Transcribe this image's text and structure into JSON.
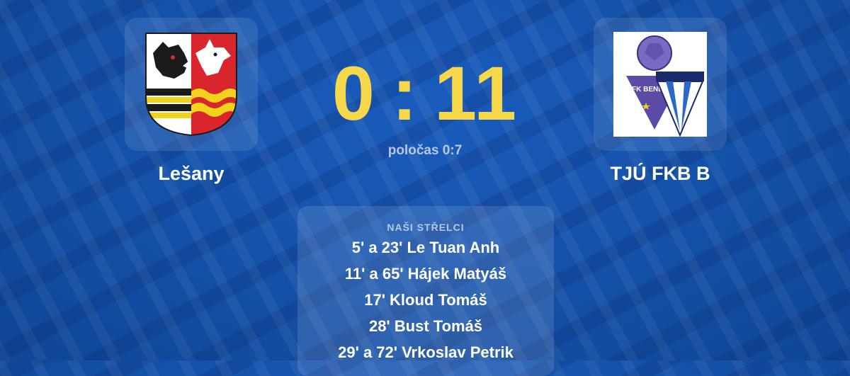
{
  "home": {
    "name": "Lešany",
    "crest": "lesany-crest"
  },
  "away": {
    "name": "TJÚ FKB B",
    "crest": "fk-benesov-crest",
    "crest_text": "FK BENE"
  },
  "score": {
    "home": "0",
    "separator": ":",
    "away": "11"
  },
  "halftime": "poločas 0:7",
  "scorers": {
    "title": "NAŠI STŘELCI",
    "items": [
      "5' a 23' Le Tuan Anh",
      "11' a 65' Hájek Matyáš",
      "17' Kloud Tomáš",
      "28' Bust Tomáš",
      "29' a 72' Vrkoslav Petrik"
    ]
  },
  "colors": {
    "background": "#1450a8",
    "score": "#f7d84a",
    "text": "#ffffff",
    "muted": "#b6c8e6"
  }
}
